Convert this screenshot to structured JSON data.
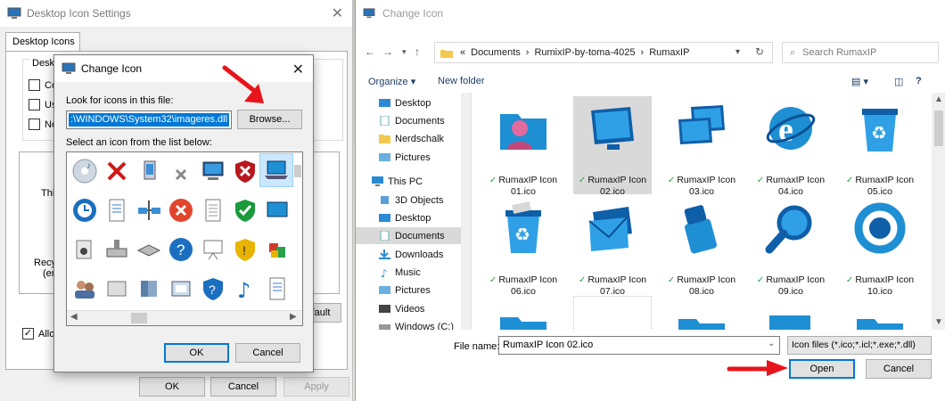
{
  "desktop_settings": {
    "title": "Desktop Icon Settings",
    "tab": "Desktop Icons",
    "group_label": "Deskto",
    "checkboxes": [
      "Cor",
      "Use",
      "Ne"
    ],
    "icon_label_this": "This",
    "icon_label_recycle": "Recyc",
    "icon_label_empty": "(em",
    "default_button_partial": "fault",
    "allow_label_partial": "Allow",
    "ok": "OK",
    "cancel": "Cancel",
    "apply": "Apply"
  },
  "change_icon": {
    "title": "Change Icon",
    "look_label": "Look for icons in this file:",
    "path_value": ":\\WINDOWS\\System32\\imageres.dll",
    "browse": "Browse...",
    "select_label": "Select an icon from the list below:",
    "ok": "OK",
    "cancel": "Cancel"
  },
  "file_open": {
    "title": "Change Icon",
    "breadcrumb": [
      "«",
      "Documents",
      "›",
      "RumixIP-by-toma-4025",
      "›",
      "RumaxIP"
    ],
    "search_placeholder": "Search RumaxIP",
    "organize": "Organize ▾",
    "new_folder": "New folder",
    "tree": [
      "Desktop",
      "Documents",
      "Nerdschalk",
      "Pictures",
      "This PC",
      "3D Objects",
      "Desktop",
      "Documents",
      "Downloads",
      "Music",
      "Pictures",
      "Videos",
      "Windows (C:)"
    ],
    "files": [
      {
        "line1": "RumaxIP Icon",
        "line2": "01.ico"
      },
      {
        "line1": "RumaxIP Icon",
        "line2": "02.ico"
      },
      {
        "line1": "RumaxIP Icon",
        "line2": "03.ico"
      },
      {
        "line1": "RumaxIP Icon",
        "line2": "04.ico"
      },
      {
        "line1": "RumaxIP Icon",
        "line2": "05.ico"
      },
      {
        "line1": "RumaxIP Icon",
        "line2": "06.ico"
      },
      {
        "line1": "RumaxIP Icon",
        "line2": "07.ico"
      },
      {
        "line1": "RumaxIP Icon",
        "line2": "08.ico"
      },
      {
        "line1": "RumaxIP Icon",
        "line2": "09.ico"
      },
      {
        "line1": "RumaxIP Icon",
        "line2": "10.ico"
      }
    ],
    "file_name_label": "File name:",
    "file_name_value": "RumaxIP Icon 02.ico",
    "file_type": "Icon files (*.ico;*.icl;*.exe;*.dll)",
    "open": "Open",
    "cancel": "Cancel"
  },
  "colors": {
    "accent": "#0078d7",
    "icon_blue": "#1f8fd4",
    "arrow_red": "#e8141b"
  }
}
